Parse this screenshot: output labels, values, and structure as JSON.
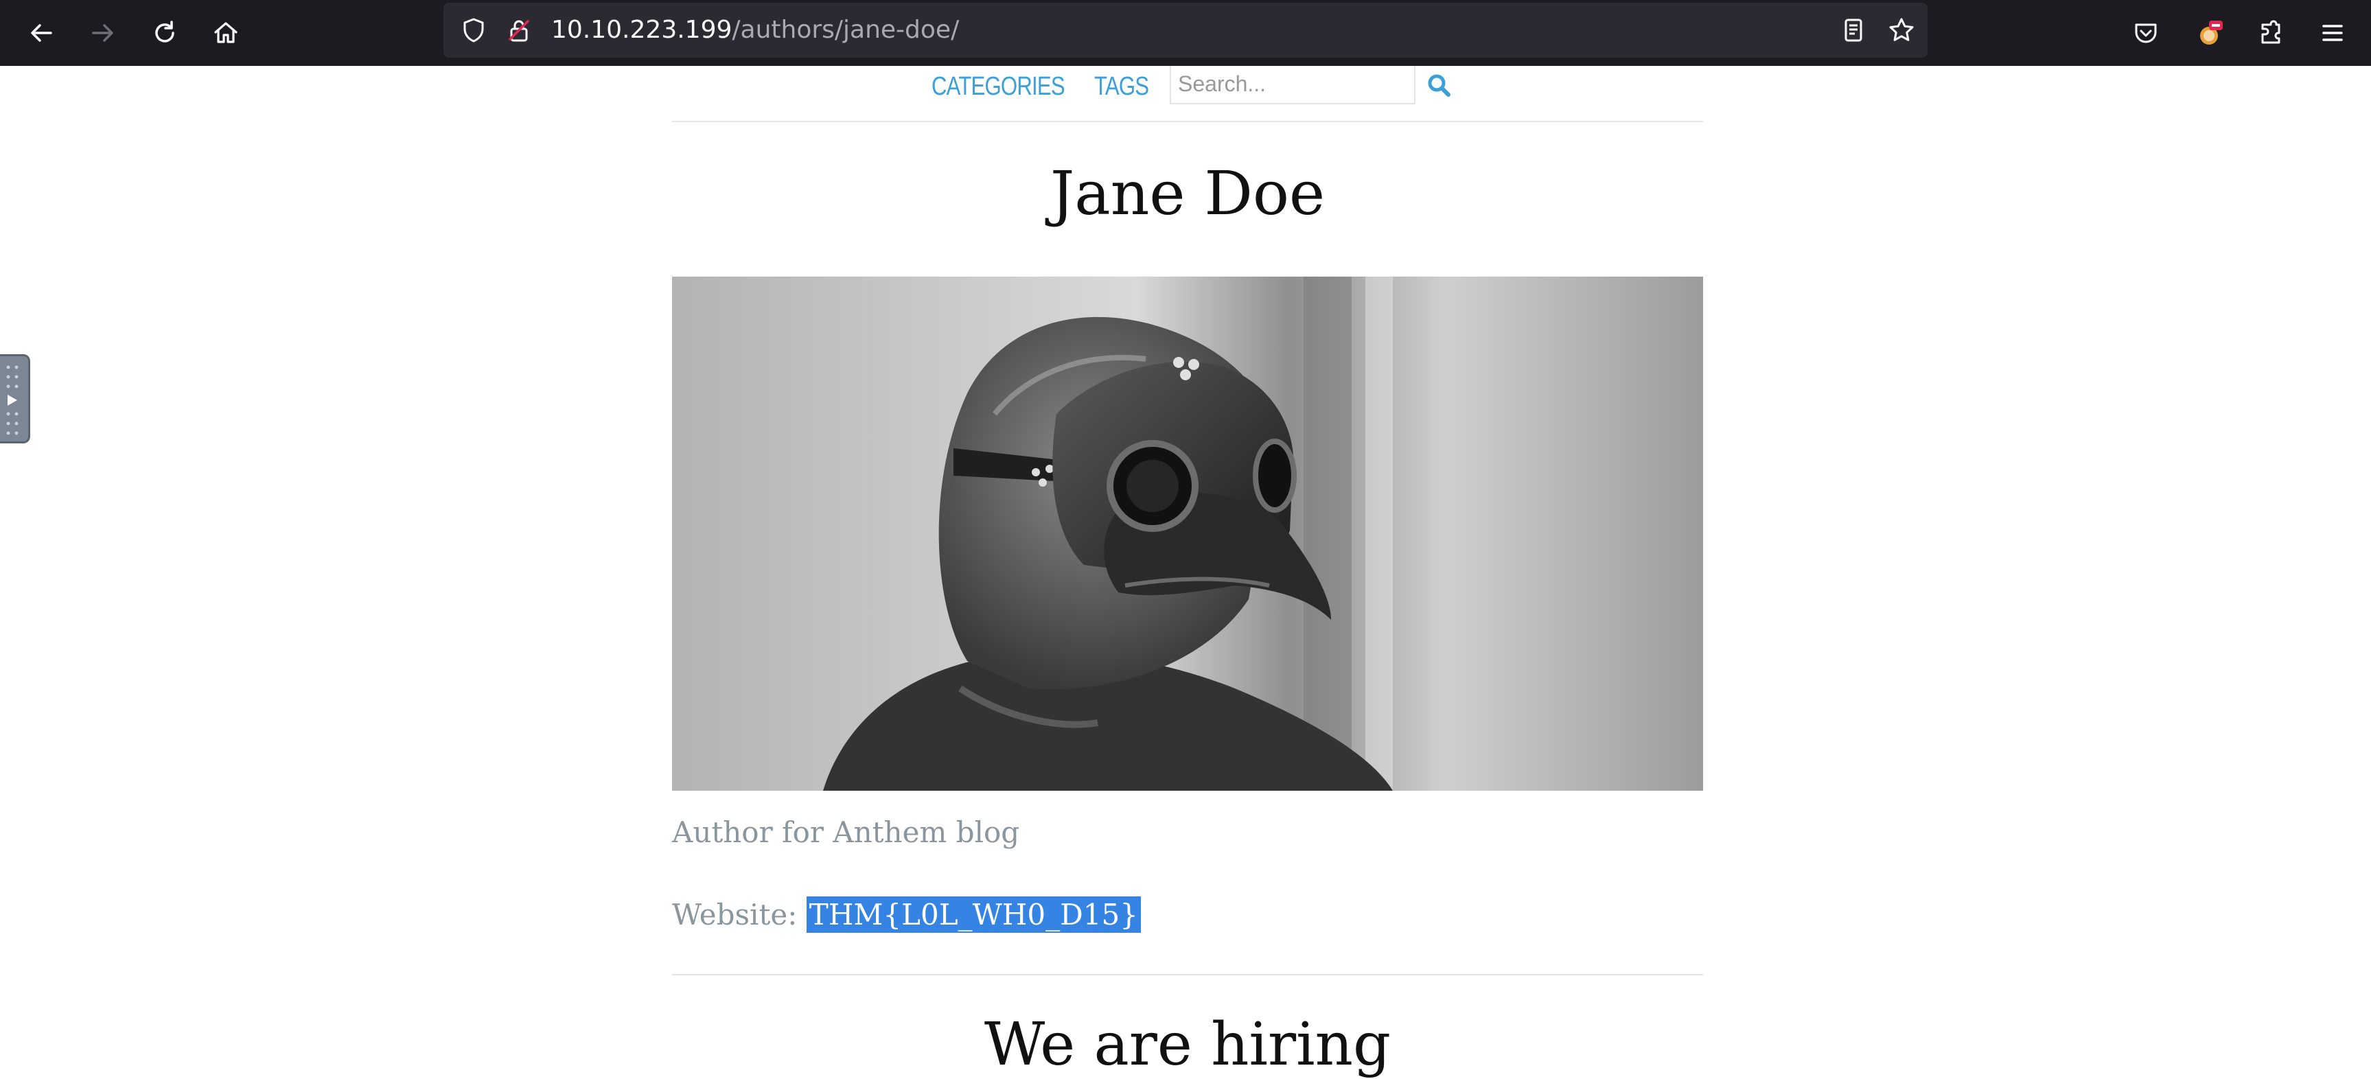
{
  "browser": {
    "url_host": "10.10.223.199",
    "url_path": "/authors/jane-doe/",
    "icons": [
      "back-icon",
      "forward-icon",
      "reload-icon",
      "home-icon",
      "shield-icon",
      "lock-icon",
      "reader-view-icon",
      "bookmark-star-icon",
      "pocket-icon",
      "profile-icon",
      "extensions-icon",
      "menu-icon"
    ]
  },
  "nav": {
    "categories": "CATEGORIES",
    "tags": "TAGS",
    "search_placeholder": "Search..."
  },
  "author": {
    "name": "Jane Doe",
    "bio": "Author for Anthem blog",
    "website_label": "Website:",
    "website_value": "THM{L0L_WH0_D15}"
  },
  "hiring": {
    "title": "We are hiring"
  },
  "colors": {
    "toolbar_bg": "#1c1b22",
    "urlbar_bg": "#2b2a33",
    "link": "#3b9fd8",
    "selection": "#3584e4",
    "muted_text": "#8a959d"
  }
}
